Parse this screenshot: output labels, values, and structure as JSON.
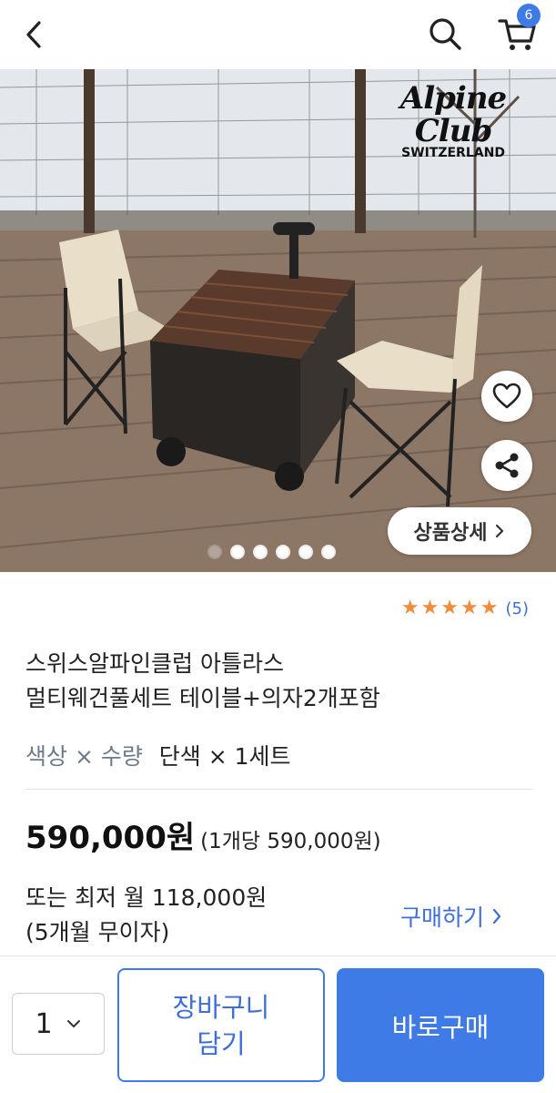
{
  "header": {
    "cart_badge": "6",
    "icons": [
      "back-arrow-icon",
      "search-icon",
      "cart-icon"
    ]
  },
  "hero": {
    "brand_line1": "Alpine Club",
    "brand_line2": "SWITZERLAND",
    "detail_button": "상품상세",
    "carousel_dots": 6,
    "active_dot": 1
  },
  "product": {
    "rating_stars": 5,
    "review_count": "(5)",
    "title_line1": "스위스알파인클럽 아틀라스",
    "title_line2": "멀티웨건풀세트 테이블+의자2개포함",
    "option_label": "색상 × 수량",
    "option_value": "단색 × 1세트",
    "price": "590,000원",
    "unit_price": "(1개당 590,000원)",
    "installment_line1": "또는 최저 월 118,000원",
    "installment_line2": "(5개월 무이자)",
    "buy_link": "구매하기"
  },
  "bottom_bar": {
    "quantity": "1",
    "cart_button_line1": "장바구니",
    "cart_button_line2": "담기",
    "buy_now_button": "바로구매"
  },
  "colors": {
    "accent": "#3e7be6",
    "link": "#3e6fd8",
    "star": "#f28c3a"
  }
}
